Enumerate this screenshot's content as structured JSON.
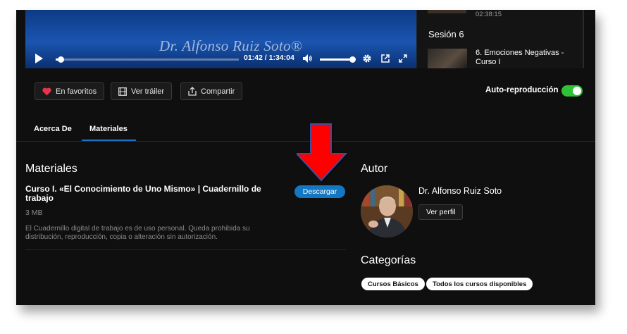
{
  "player": {
    "watermark": "Dr. Alfonso Ruiz Soto®",
    "current_time": "01:42",
    "separator": "/",
    "duration": "1:34:04",
    "progress_fraction": 0.017,
    "volume_fraction": 0.9
  },
  "playlist": {
    "prev_duration": "02:38:15",
    "session_label": "Sesión 6",
    "item_title": "6. Emociones Negativas - Curso I"
  },
  "actions": {
    "favorites_label": "En favoritos",
    "trailer_label": "Ver tráiler",
    "share_label": "Compartir",
    "autoplay_label": "Auto-reproducción",
    "autoplay_on": true
  },
  "tabs": {
    "about_label": "Acerca De",
    "materials_label": "Materiales",
    "active": "Materiales"
  },
  "materials": {
    "heading": "Materiales",
    "item_title": "Curso I. «El Conocimiento de Uno Mismo» | Cuadernillo de trabajo",
    "item_size": "3 MB",
    "item_description": "El Cuadernillo digital de trabajo es de uso personal. Queda prohibida su distribución, reproducción, copia o alteración sin autorización.",
    "download_label": "Descargar"
  },
  "author": {
    "heading": "Autor",
    "name": "Dr. Alfonso Ruiz Soto",
    "profile_label": "Ver perfil"
  },
  "categories": {
    "heading": "Categorías",
    "items": [
      "Cursos Básicos",
      "Todos los cursos disponibles"
    ]
  },
  "colors": {
    "accent_blue": "#1477c2",
    "toggle_green": "#2fc136",
    "arrow_red": "#ff0000",
    "favorite_red": "#e8334a"
  }
}
